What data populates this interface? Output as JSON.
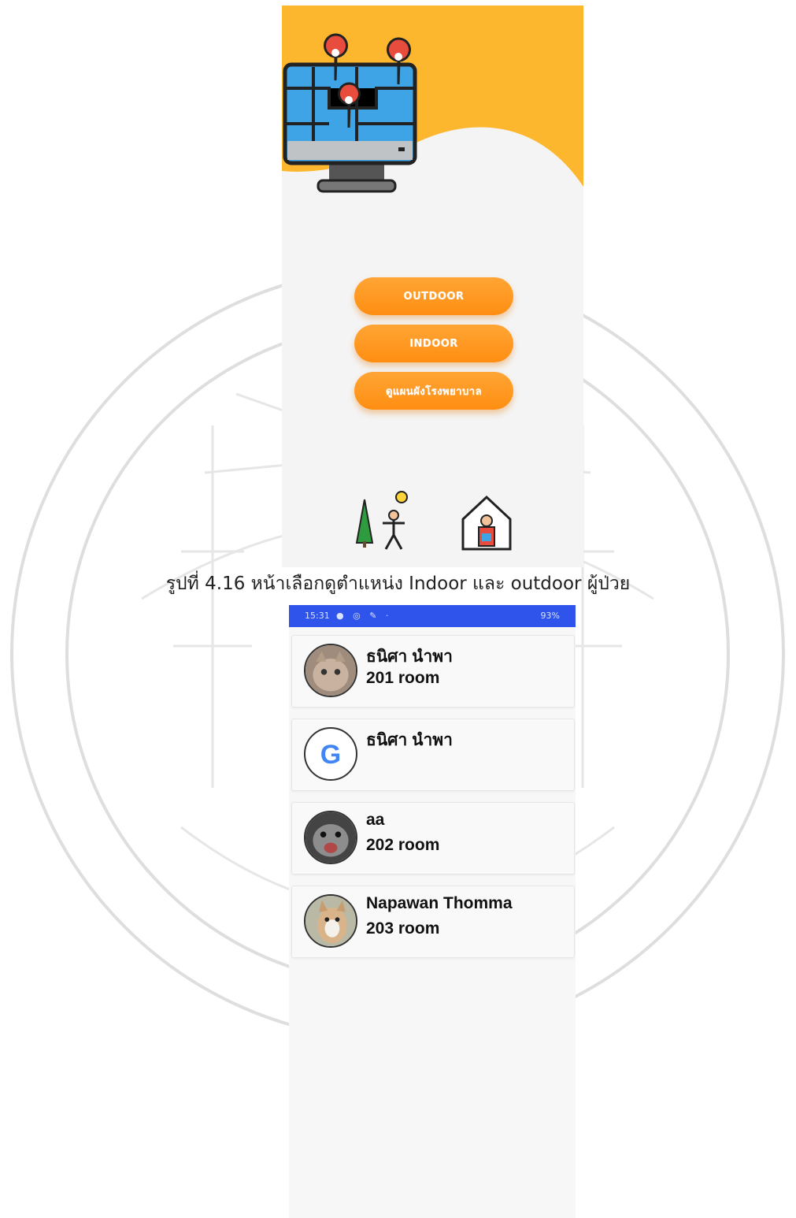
{
  "caption": "รูปที่ 4.16 หน้าเลือกดูตำแหน่ง Indoor และ outdoor ผู้ป่วย",
  "screen1": {
    "buttons": [
      "OUTDOOR",
      "INDOOR",
      "ดูแผนผังโรงพยาบาล"
    ],
    "hero_icon": "map-monitor-icon",
    "icons": [
      "outdoor-person-icon",
      "indoor-house-icon"
    ]
  },
  "screen2": {
    "status": {
      "time": "15:31",
      "right": "93%"
    },
    "patients": [
      {
        "name": "ธนิศา นำพา",
        "room": "201 room",
        "avatar": "cat-avatar"
      },
      {
        "name": "ธนิศา นำพา",
        "room": "",
        "avatar": "google-avatar"
      },
      {
        "name": "aa",
        "room": "202 room",
        "avatar": "cat-avatar"
      },
      {
        "name": "Napawan Thomma",
        "room": "203 room",
        "avatar": "dog-avatar"
      }
    ]
  },
  "colors": {
    "accent": "#FFA535",
    "hero": "#FDB72E",
    "statusbar": "#2F54EB"
  }
}
